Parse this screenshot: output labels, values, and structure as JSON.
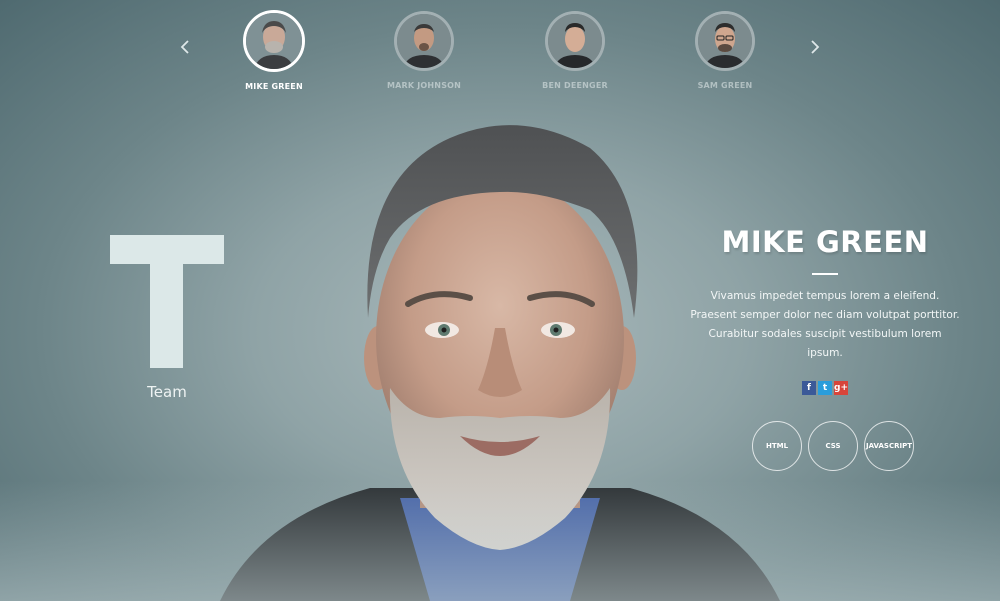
{
  "carousel": {
    "prev_icon": "chevron-left",
    "next_icon": "chevron-right",
    "members": [
      {
        "name": "MIKE GREEN",
        "active": true
      },
      {
        "name": "MARK JOHNSON",
        "active": false
      },
      {
        "name": "BEN DEENGER",
        "active": false
      },
      {
        "name": "SAM GREEN",
        "active": false
      }
    ]
  },
  "section": {
    "letter": "T",
    "label": "Team"
  },
  "profile": {
    "name": "MIKE GREEN",
    "bio": "Vivamus impedet tempus lorem a eleifend. Praesent semper dolor nec diam volutpat porttitor. Curabitur sodales suscipit vestibulum lorem ipsum.",
    "social": [
      {
        "label": "f",
        "icon": "facebook-icon",
        "color": "#3b5998"
      },
      {
        "label": "t",
        "icon": "twitter-icon",
        "color": "#2a9ddb"
      },
      {
        "label": "g+",
        "icon": "google-plus-icon",
        "color": "#d8453a"
      }
    ],
    "skills": [
      "HTML",
      "CSS",
      "JAVASCRIPT"
    ]
  },
  "colors": {
    "background": "#6d8589",
    "text": "#ffffff",
    "accent_light": "#dce8e8"
  }
}
